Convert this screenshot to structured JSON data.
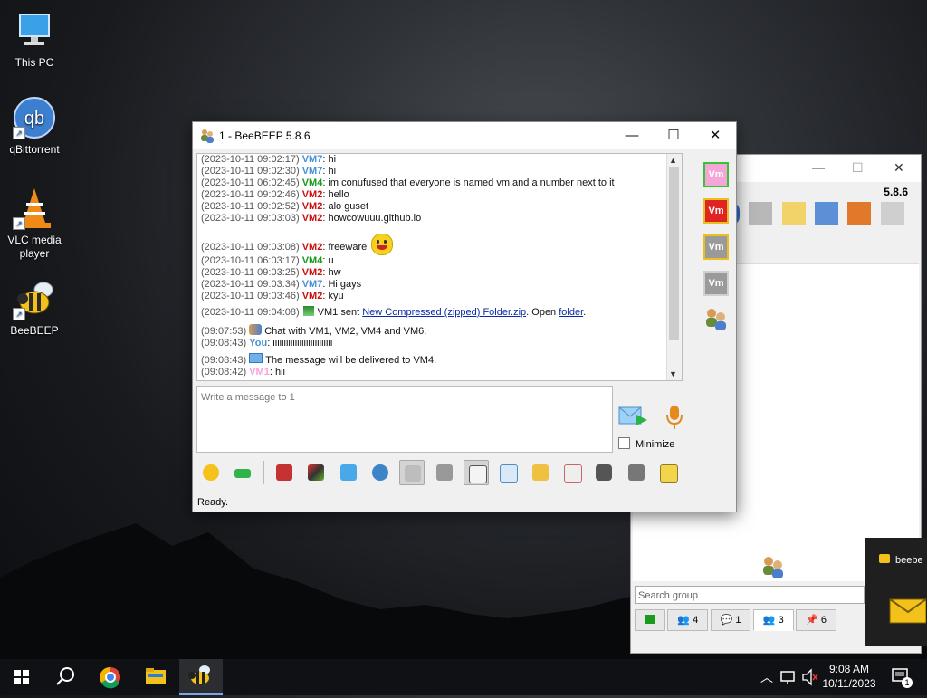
{
  "desktop": {
    "icons": [
      {
        "label": "This PC"
      },
      {
        "label": "qBittorrent"
      },
      {
        "label": "VLC media player"
      },
      {
        "label": "BeeBEEP"
      }
    ]
  },
  "background_window": {
    "version": "5.8.6",
    "search_placeholder": "Search group",
    "tabs": [
      {
        "label": "4"
      },
      {
        "label": "1"
      },
      {
        "label": "3"
      },
      {
        "label": "6"
      }
    ],
    "notification_text": "beebe"
  },
  "main_window": {
    "title": "1 - BeeBEEP 5.8.6",
    "messages": [
      {
        "ts": "(2023-10-11 09:02:17)",
        "who": "VM7",
        "color": "#4a90d9",
        "text": ": hi"
      },
      {
        "ts": "(2023-10-11 09:02:30)",
        "who": "VM7",
        "color": "#4a90d9",
        "text": ": hi"
      },
      {
        "ts": "(2023-10-11 06:02:45)",
        "who": "VM4",
        "color": "#1a9a1a",
        "text": ": im conufused that everyone is named vm and a number next to it"
      },
      {
        "ts": "(2023-10-11 09:02:46)",
        "who": "VM2",
        "color": "#cc1111",
        "text": ": hello"
      },
      {
        "ts": "(2023-10-11 09:02:52)",
        "who": "VM2",
        "color": "#cc1111",
        "text": ": alo guset"
      },
      {
        "ts": "(2023-10-11 09:03:03)",
        "who": "VM2",
        "color": "#cc1111",
        "text": ": howcowuuu.github.io"
      },
      {
        "ts": "(2023-10-11 09:03:08)",
        "who": "VM2",
        "color": "#cc1111",
        "text": ": freeware"
      },
      {
        "ts": "(2023-10-11 06:03:17)",
        "who": "VM4",
        "color": "#1a9a1a",
        "text": ": u"
      },
      {
        "ts": "(2023-10-11 09:03:25)",
        "who": "VM2",
        "color": "#cc1111",
        "text": ": hw"
      },
      {
        "ts": "(2023-10-11 09:03:34)",
        "who": "VM7",
        "color": "#4a90d9",
        "text": ": Hi gays"
      },
      {
        "ts": "(2023-10-11 09:03:46)",
        "who": "VM2",
        "color": "#cc1111",
        "text": ": kyu"
      }
    ],
    "file_event": {
      "ts": "(2023-10-11 09:04:08)",
      "pre": "VM1 sent ",
      "file_link": "New Compressed (zipped) Folder.zip",
      "mid": ". Open ",
      "folder_link": "folder",
      "post": "."
    },
    "system_lines": [
      {
        "ts": "(09:07:53)",
        "text": "Chat with VM1, VM2, VM4 and VM6."
      },
      {
        "ts": "(09:08:43)",
        "who": "You",
        "text": ": iiiiiiiiiiiiiiiiiiiiiiiiiii"
      },
      {
        "ts": "(09:08:43)",
        "text": "The message will be delivered to VM4."
      },
      {
        "ts": "(09:08:42)",
        "who": "VM1",
        "text": ": hii"
      }
    ],
    "users": [
      {
        "label": "Vm",
        "bg": "#f4a6d6",
        "border": "#39c339"
      },
      {
        "label": "Vm",
        "bg": "#e02424",
        "border": "#e8c020"
      },
      {
        "label": "Vm",
        "bg": "#9a9a9a",
        "border": "#e8c020"
      },
      {
        "label": "Vm",
        "bg": "#9a9a9a",
        "border": "#d0d0d0"
      }
    ],
    "compose_placeholder": "Write a message to 1",
    "minimize_label": "Minimize",
    "status": "Ready."
  },
  "taskbar": {
    "time": "9:08 AM",
    "date": "10/11/2023",
    "notification_count": "1"
  }
}
